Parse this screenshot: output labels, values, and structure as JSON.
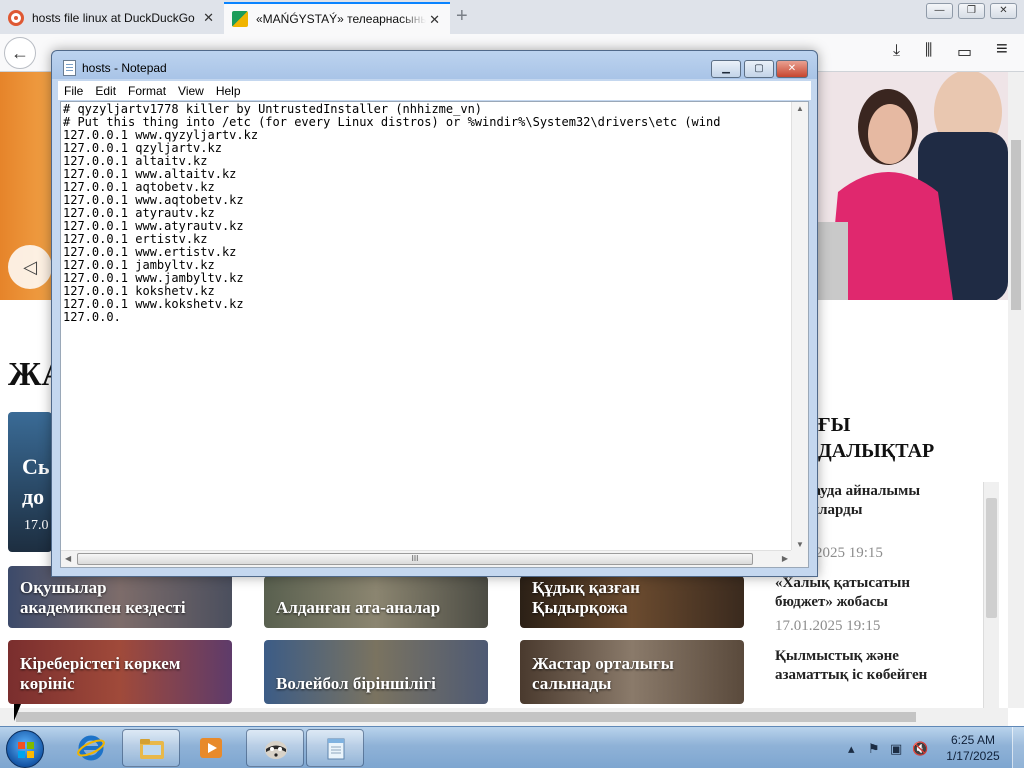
{
  "browser": {
    "tabs": [
      {
        "title": "hosts file linux at DuckDuckGo",
        "close": "✕"
      },
      {
        "title": "«MAŃǴYSTAÝ» телеарнасының",
        "close": "✕"
      }
    ],
    "new_tab": "+",
    "window_buttons": {
      "minimize": "—",
      "maximize": "❐",
      "close": "✕"
    },
    "back": "←",
    "toolbar_icons": {
      "downloads": "⤓",
      "library": "⫼",
      "sidebar": "▭",
      "menu": "≡"
    }
  },
  "page": {
    "section_heading": "ЖА",
    "slide_prev": "◁",
    "sidebar_heading_line1": "ҒЫ",
    "sidebar_heading_line2": "ДАЛЫҚТАР",
    "sidebar_items": [
      {
        "title": "ақы сауда айналымы\nлн долларды\nды",
        "date": "2025 19:15"
      },
      {
        "title": "«Халық қатысатын\nбюджет» жобасы",
        "date": "17.01.2025 19:15"
      },
      {
        "title": "Қылмыстық және\nазаматтық іс көбейген",
        "date": ""
      }
    ],
    "feature_card": {
      "title_line1": "Сь",
      "title_line2": "до",
      "date": "17.0"
    },
    "cards": [
      {
        "caption": "Оқушылар\nакадемикпен кездесті"
      },
      {
        "caption": "Алданған ата-аналар"
      },
      {
        "caption": "Құдық қазған\nҚыдырқожа"
      },
      {
        "caption": "Кіреберістегі көркем\nкөрініс"
      },
      {
        "caption": "Волейбол біріншілігі"
      },
      {
        "caption": "Жастар орталығы\nсалынады"
      }
    ]
  },
  "notepad": {
    "title": "hosts - Notepad",
    "buttons": {
      "minimize": "▁",
      "maximize": "▢",
      "close": "✕"
    },
    "menu": [
      "File",
      "Edit",
      "Format",
      "View",
      "Help"
    ],
    "content": "# qyzyljartv1778 killer by UntrustedInstaller (nhhizme_vn)\n# Put this thing into /etc (for every Linux distros) or %windir%\\System32\\drivers\\etc (wind\n127.0.0.1 www.qyzyljartv.kz\n127.0.0.1 qzyljartv.kz\n127.0.0.1 altaitv.kz\n127.0.0.1 www.altaitv.kz\n127.0.0.1 aqtobetv.kz\n127.0.0.1 www.aqtobetv.kz\n127.0.0.1 atyrautv.kz\n127.0.0.1 www.atyrautv.kz\n127.0.0.1 ertistv.kz\n127.0.0.1 www.ertistv.kz\n127.0.0.1 jambyltv.kz\n127.0.0.1 www.jambyltv.kz\n127.0.0.1 kokshetv.kz\n127.0.0.1 www.kokshetv.kz\n127.0.0.",
    "hscroll_grip": "III"
  },
  "taskbar": {
    "clock_time": "6:25 AM",
    "clock_date": "1/17/2025",
    "tray_icons": {
      "show_hidden": "▴",
      "action_center": "⚑",
      "network": "▣",
      "volume": "🔇"
    }
  },
  "colors": {
    "accent_tab": "#0a84ff",
    "taskbar": "#8fb2d7",
    "notepad_frame": "#a9c4e7"
  }
}
